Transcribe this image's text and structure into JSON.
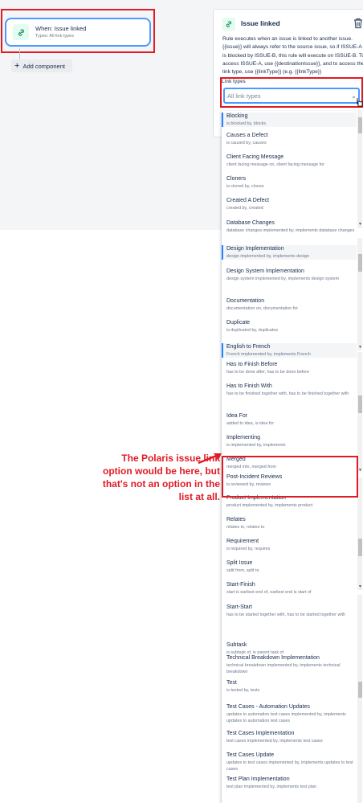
{
  "canvas": {
    "trigger": {
      "title": "When: Issue linked",
      "subtitle": "Types: All link types"
    },
    "add_component_label": "Add component"
  },
  "panel": {
    "title": "Issue linked",
    "description": "Rule executes when an issue is linked to another issue. {{issue}} will always refer to the source issue, so if ISSUE-A is blocked by ISSUE-B, this rule will execute on ISSUE-B. To access ISSUE-A, use {{destinationIssue}}, and to access the link type, use {{linkType}} (e.g. {{linkType}}",
    "field_label": "Link types",
    "field_placeholder": "All link types"
  },
  "dropdown": {
    "options": [
      {
        "title": "Blocking",
        "desc": "is blocked by, blocks"
      },
      {
        "title": "Causes a Defect",
        "desc": "is caused by, causes"
      },
      {
        "title": "Client Facing Message",
        "desc": "client facing message on, client facing message for"
      },
      {
        "title": "Cloners",
        "desc": "is cloned by, clones"
      },
      {
        "title": "Created A Defect",
        "desc": "created by, created"
      },
      {
        "title": "Database Changes",
        "desc": "database changes implemented by, implements database changes"
      },
      {
        "title": "Design Implementation",
        "desc": "design implemented by, implements design"
      },
      {
        "title": "Design System Implementation",
        "desc": "design system implemented by, implements design system"
      },
      {
        "title": "Documentation",
        "desc": "documentation on, documentation for"
      },
      {
        "title": "Duplicate",
        "desc": "is duplicated by, duplicates"
      },
      {
        "title": "English to French",
        "desc": "French implemented by, implements French"
      },
      {
        "title": "Has to Finish Before",
        "desc": "has to be done after, has to be done before"
      },
      {
        "title": "Has to Finish With",
        "desc": "has to be finished together with, has to be finished together with"
      },
      {
        "title": "Idea For",
        "desc": "added to idea, is idea for"
      },
      {
        "title": "Implementing",
        "desc": "is implemented by, implements"
      },
      {
        "title": "Merged",
        "desc": "merged into, merged from"
      },
      {
        "title": "Post-Incident Reviews",
        "desc": "is reviewed by, reviews"
      },
      {
        "title": "Product Implementation",
        "desc": "product implemented by, implements product"
      },
      {
        "title": "Relates",
        "desc": "relates to, relates to"
      },
      {
        "title": "Requirement",
        "desc": "is required by, requires"
      },
      {
        "title": "Split Issue",
        "desc": "split from, split to"
      },
      {
        "title": "Start-Finish",
        "desc": "start is earliest end of, earliest end is start of"
      },
      {
        "title": "Start-Start",
        "desc": "has to be started together with, has to be started together with"
      },
      {
        "title": "Subtask",
        "desc": "is subtask of, is parent task of"
      },
      {
        "title": "Technical Breakdown Implementation",
        "desc": "technical breakdown implemented by, implements technical breakdown"
      },
      {
        "title": "Test",
        "desc": "is tested by, tests"
      },
      {
        "title": "Test Cases - Automation Updates",
        "desc": "updates to automation test cases implemented by, implements updates to automation test cases"
      },
      {
        "title": "Test Cases Implementation",
        "desc": "test cases implemented by, implements test cases"
      },
      {
        "title": "Test Cases Update",
        "desc": "updates to test cases implemented by, implements updates to test cases"
      },
      {
        "title": "Test Plan Implementation",
        "desc": "test plan implemented by, implements test plan"
      }
    ]
  },
  "annotation": {
    "text": "The Polaris issue link option would be here, but that's not an option in the list at all."
  },
  "colors": {
    "accent": "#4c9aff",
    "annotation": "#e01b24",
    "icon_bg": "#e3fcef",
    "icon_fg": "#00875a"
  },
  "icons": [
    "link-icon",
    "trash-icon",
    "plus-icon",
    "chevron-down-icon"
  ]
}
